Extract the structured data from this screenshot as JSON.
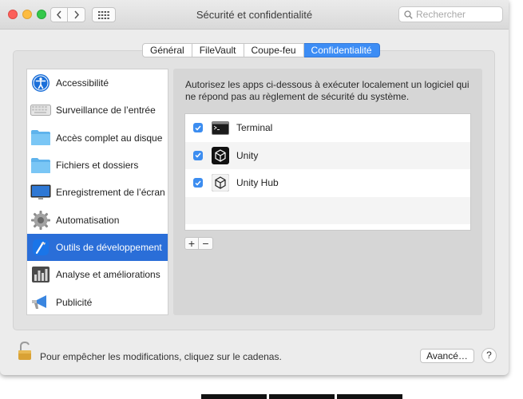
{
  "window": {
    "title": "Sécurité et confidentialité"
  },
  "toolbar": {
    "back_icon": "chevron-left",
    "forward_icon": "chevron-right",
    "grid_icon": "grid"
  },
  "search": {
    "placeholder": "Rechercher"
  },
  "tabs": [
    {
      "label": "Général",
      "active": false
    },
    {
      "label": "FileVault",
      "active": false
    },
    {
      "label": "Coupe-feu",
      "active": false
    },
    {
      "label": "Confidentialité",
      "active": true
    }
  ],
  "sidebar": {
    "items": [
      {
        "label": "Accessibilité",
        "icon": "accessibility-icon",
        "selected": false
      },
      {
        "label": "Surveillance de l’entrée",
        "icon": "keyboard-icon",
        "selected": false
      },
      {
        "label": "Accès complet au disque",
        "icon": "folder-icon",
        "selected": false
      },
      {
        "label": "Fichiers et dossiers",
        "icon": "folder-icon",
        "selected": false
      },
      {
        "label": "Enregistrement de l’écran",
        "icon": "display-icon",
        "selected": false
      },
      {
        "label": "Automatisation",
        "icon": "gear-icon",
        "selected": false
      },
      {
        "label": "Outils de développement",
        "icon": "xcode-icon",
        "selected": true
      },
      {
        "label": "Analyse et améliorations",
        "icon": "chart-icon",
        "selected": false
      },
      {
        "label": "Publicité",
        "icon": "megaphone-icon",
        "selected": false
      }
    ]
  },
  "content": {
    "description": "Autorisez les apps ci-dessous à exécuter localement un logiciel qui ne répond pas au règlement de sécurité du système.",
    "apps": [
      {
        "label": "Terminal",
        "checked": true,
        "icon": "terminal-icon"
      },
      {
        "label": "Unity",
        "checked": true,
        "icon": "unity-icon"
      },
      {
        "label": "Unity Hub",
        "checked": true,
        "icon": "unity-hub-icon"
      }
    ],
    "add_label": "+",
    "remove_label": "−"
  },
  "footer": {
    "lock_text": "Pour empêcher les modifications, cliquez sur le cadenas.",
    "advanced_label": "Avancé…",
    "help_label": "?"
  },
  "colors": {
    "accent": "#3d8df5",
    "selection": "#2a6ed8"
  }
}
